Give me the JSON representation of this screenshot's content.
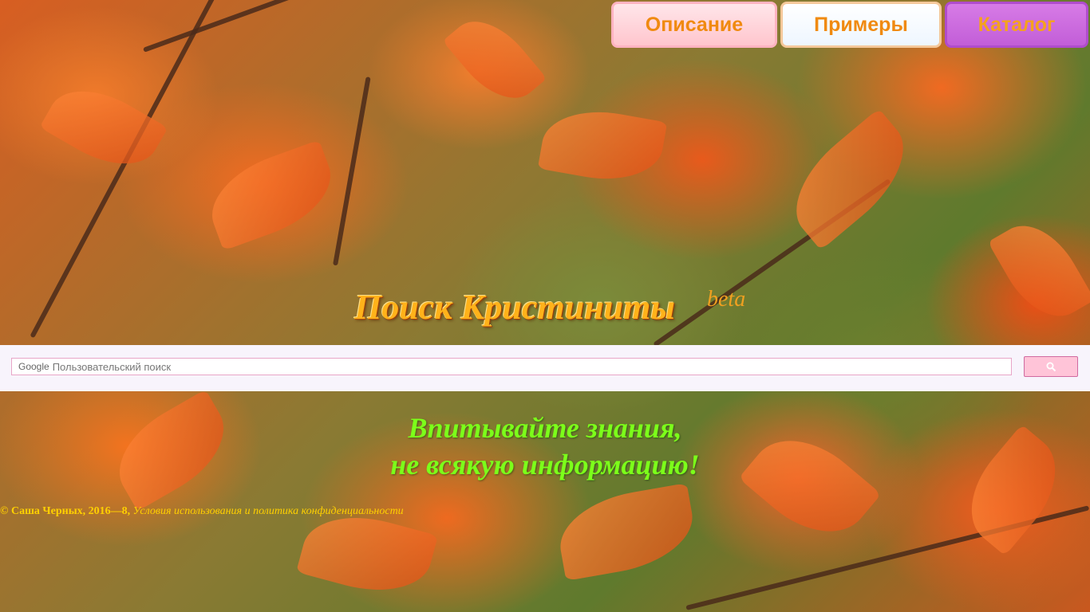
{
  "nav": {
    "items": [
      {
        "label": "Описание"
      },
      {
        "label": "Примеры"
      },
      {
        "label": "Каталог"
      }
    ]
  },
  "header": {
    "title": "Поиск Кристиниты",
    "badge": "beta"
  },
  "search": {
    "brand": "Google",
    "placeholder": "Пользовательский поиск",
    "button_icon": "search-icon"
  },
  "slogan": {
    "line1": "Впитывайте знания,",
    "line2": "не всякую информацию!"
  },
  "footer": {
    "copyright": "© Саша Черных, 2016—8,",
    "terms_link": "Условия использования и политика конфиденциальности"
  },
  "colors": {
    "title": "#ffb21a",
    "slogan": "#7cff1a",
    "nav_text": "#f08a10",
    "catalog_bg": "#c25ed8",
    "search_button": "#ffc4d8"
  }
}
